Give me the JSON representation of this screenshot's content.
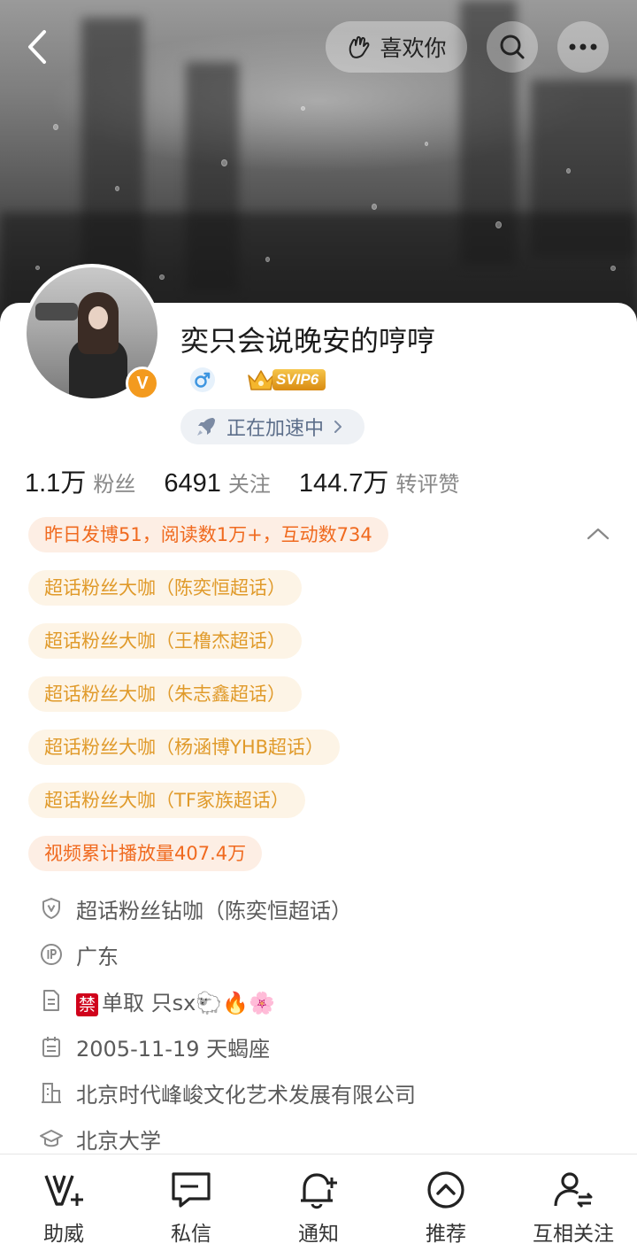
{
  "header": {
    "like_label": "喜欢你"
  },
  "profile": {
    "username": "奕只会说晚安的哼哼",
    "verified_badge": "V",
    "vip_label": "SVIP6",
    "boost_label": "正在加速中"
  },
  "stats": [
    {
      "value": "1.1万",
      "label": "粉丝"
    },
    {
      "value": "6491",
      "label": "关注"
    },
    {
      "value": "144.7万",
      "label": "转评赞"
    }
  ],
  "tags": [
    {
      "text": "昨日发博51，阅读数1万+，互动数734",
      "style": "orange"
    },
    {
      "text": "超话粉丝大咖（陈奕恒超话）",
      "style": "gold"
    },
    {
      "text": "超话粉丝大咖（王橹杰超话）",
      "style": "gold"
    },
    {
      "text": "超话粉丝大咖（朱志鑫超话）",
      "style": "gold"
    },
    {
      "text": "超话粉丝大咖（杨涵博YHB超话）",
      "style": "gold"
    },
    {
      "text": "超话粉丝大咖（TF家族超话）",
      "style": "gold"
    },
    {
      "text": "视频累计播放量407.4万",
      "style": "orange"
    }
  ],
  "info": {
    "badge": "超话粉丝钻咖（陈奕恒超话）",
    "ip_location": "广东",
    "bio_ban": "禁",
    "bio_text": "单取 只sx🐑🔥🌸",
    "birthday": "2005-11-19 天蝎座",
    "company": "北京时代峰峻文化艺术发展有限公司",
    "school": "北京大学"
  },
  "tabbar": [
    {
      "label": "助威",
      "icon": "cheer-icon"
    },
    {
      "label": "私信",
      "icon": "message-icon"
    },
    {
      "label": "通知",
      "icon": "bell-icon"
    },
    {
      "label": "推荐",
      "icon": "recommend-icon"
    },
    {
      "label": "互相关注",
      "icon": "mutual-follow-icon"
    }
  ],
  "colors": {
    "accent_orange": "#f06a1f",
    "gold": "#e09a2a",
    "verified": "#f39a1e"
  }
}
